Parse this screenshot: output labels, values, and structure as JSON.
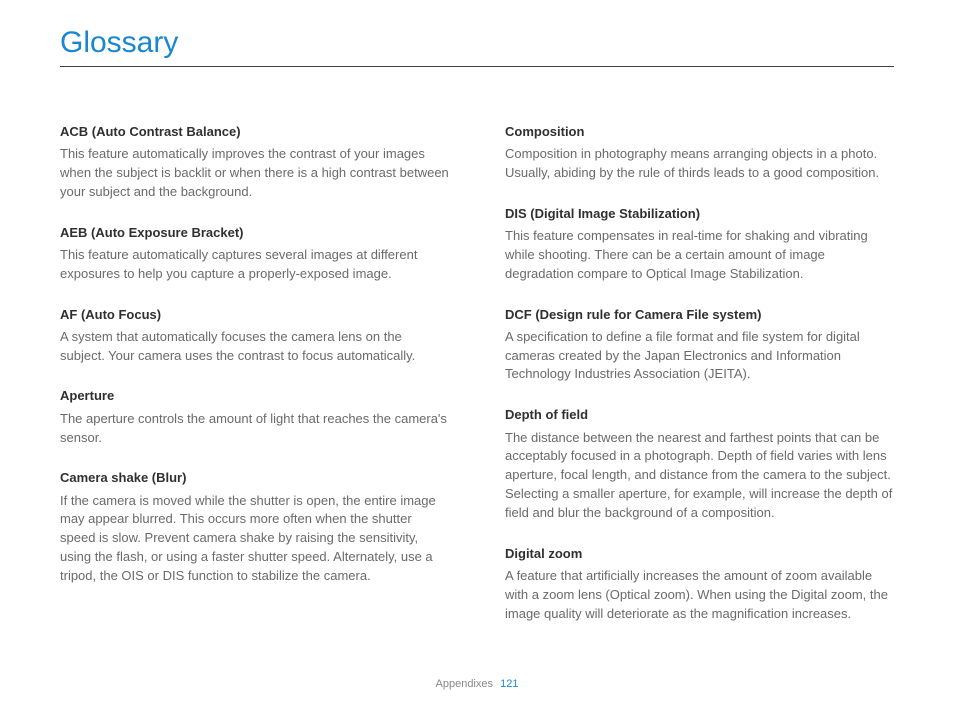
{
  "title": "Glossary",
  "footer": {
    "section": "Appendixes",
    "page": "121"
  },
  "columns": [
    [
      {
        "term": "ACB (Auto Contrast Balance)",
        "def": "This feature automatically improves the contrast of your images when the subject is backlit or when there is a high contrast between your subject and the background."
      },
      {
        "term": "AEB (Auto Exposure Bracket)",
        "def": "This feature automatically captures several images at different exposures to help you capture a properly-exposed image."
      },
      {
        "term": "AF (Auto Focus)",
        "def": "A system that automatically focuses the camera lens on the subject. Your camera uses the contrast to focus automatically."
      },
      {
        "term": "Aperture",
        "def": "The aperture controls the amount of light that reaches the camera's sensor."
      },
      {
        "term": "Camera shake (Blur)",
        "def": "If the camera is moved while the shutter is open, the entire image may appear blurred. This occurs more often when the shutter speed is slow. Prevent camera shake by raising the sensitivity, using the flash, or using a faster shutter speed. Alternately, use a tripod, the OIS or DIS function to stabilize the camera."
      }
    ],
    [
      {
        "term": "Composition",
        "def": "Composition in photography means arranging objects in a photo. Usually, abiding by the rule of thirds leads to a good composition."
      },
      {
        "term": "DIS (Digital Image Stabilization)",
        "def": "This feature compensates in real-time for shaking and vibrating while shooting. There can be a certain amount of image degradation compare to Optical Image Stabilization."
      },
      {
        "term": "DCF (Design rule for Camera File system)",
        "def": "A specification to define a file format and file system for digital cameras created by the Japan Electronics and Information Technology Industries Association (JEITA)."
      },
      {
        "term": "Depth of field",
        "def": "The distance between the nearest and farthest points that can be acceptably focused in a photograph. Depth of field varies with lens aperture, focal length, and distance from the camera to the subject. Selecting a smaller aperture, for example, will increase the depth of field and blur the background of a composition."
      },
      {
        "term": "Digital zoom",
        "def": "A feature that artificially increases the amount of zoom available with a zoom lens (Optical zoom). When using the Digital zoom, the image quality will deteriorate as the magnification increases."
      }
    ]
  ]
}
